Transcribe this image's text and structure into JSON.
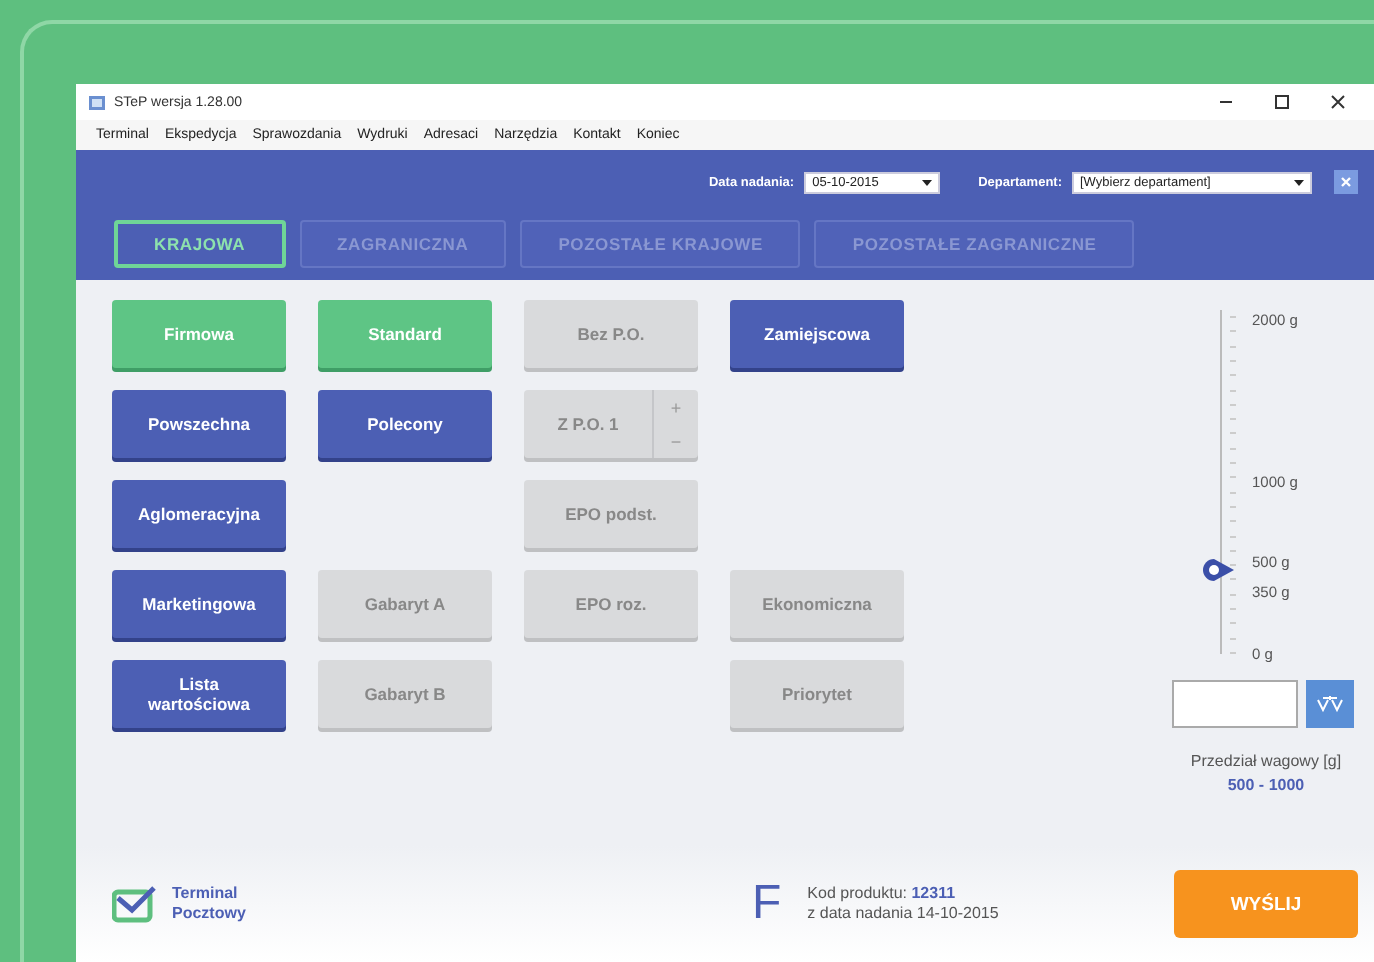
{
  "window": {
    "title": "STeP wersja 1.28.00"
  },
  "menu": [
    "Terminal",
    "Ekspedycja",
    "Sprawozdania",
    "Wydruki",
    "Adresaci",
    "Narzędzia",
    "Kontakt",
    "Koniec"
  ],
  "filters": {
    "date_label": "Data nadania:",
    "date_value": "05-10-2015",
    "department_label": "Departament:",
    "department_value": "[Wybierz departament]"
  },
  "tabs": [
    {
      "label": "KRAJOWA",
      "selected": true
    },
    {
      "label": "ZAGRANICZNA",
      "selected": false
    },
    {
      "label": "POZOSTAŁE KRAJOWE",
      "selected": false
    },
    {
      "label": "POZOSTAŁE ZAGRANICZNE",
      "selected": false
    }
  ],
  "grid": [
    [
      {
        "kind": "button",
        "label": "Firmowa",
        "selected": true,
        "disabled": false
      },
      {
        "kind": "button",
        "label": "Standard",
        "selected": true,
        "disabled": false
      },
      {
        "kind": "button",
        "label": "Bez P.O.",
        "selected": false,
        "disabled": true
      },
      {
        "kind": "button",
        "label": "Zamiejscowa",
        "selected": false,
        "disabled": false
      }
    ],
    [
      {
        "kind": "button",
        "label": "Powszechna",
        "selected": false,
        "disabled": false
      },
      {
        "kind": "button",
        "label": "Polecony",
        "selected": false,
        "disabled": false
      },
      {
        "kind": "stepper",
        "label": "Z P.O. 1",
        "plus": "+",
        "minus": "−",
        "selected": false,
        "disabled": true
      },
      {
        "kind": "empty"
      }
    ],
    [
      {
        "kind": "button",
        "label": "Aglomeracyjna",
        "selected": false,
        "disabled": false
      },
      {
        "kind": "empty"
      },
      {
        "kind": "button",
        "label": "EPO podst.",
        "selected": false,
        "disabled": true
      },
      {
        "kind": "empty"
      }
    ],
    [
      {
        "kind": "button",
        "label": "Marketingowa",
        "selected": false,
        "disabled": false
      },
      {
        "kind": "button",
        "label": "Gabaryt A",
        "selected": false,
        "disabled": true
      },
      {
        "kind": "button",
        "label": "EPO roz.",
        "selected": false,
        "disabled": true
      },
      {
        "kind": "button",
        "label": "Ekonomiczna",
        "selected": false,
        "disabled": true
      }
    ],
    [
      {
        "kind": "button",
        "label": "Lista wartościowa",
        "selected": false,
        "disabled": false
      },
      {
        "kind": "button",
        "label": "Gabaryt B",
        "selected": false,
        "disabled": true
      },
      {
        "kind": "empty"
      },
      {
        "kind": "button",
        "label": "Priorytet",
        "selected": false,
        "disabled": true
      }
    ]
  ],
  "weight": {
    "scale_labels": [
      "2000 g",
      "1000 g",
      "500 g",
      "350 g",
      "0 g"
    ],
    "level": 0.25,
    "range_label": "Przedział wagowy [g]",
    "range_value": "500 - 1000"
  },
  "footer": {
    "logo_text": "Terminal Pocztowy",
    "letter": "F",
    "product_label": "Kod produktu:",
    "product_code": "12311",
    "date_line": "z data nadania 14-10-2015",
    "send": "WYŚLIJ"
  }
}
